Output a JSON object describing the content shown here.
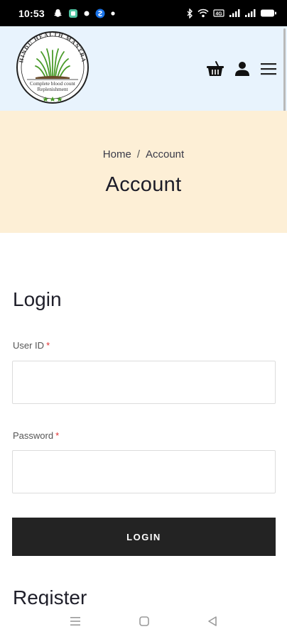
{
  "status_bar": {
    "time": "10:53",
    "left_icons": [
      "snapchat-icon",
      "app-icon",
      "dot-icon",
      "shazam-icon",
      "dot-icon"
    ],
    "right_icons": [
      "bluetooth-icon",
      "wifi-icon",
      "volte-icon",
      "signal-icon",
      "signal-icon",
      "battery-icon"
    ]
  },
  "header": {
    "logo": {
      "top_text": "HINDU HEALTH MANTRA",
      "line1": "Complete blood count",
      "line2": "Replenishment"
    },
    "icons": [
      "basket-icon",
      "user-icon",
      "menu-icon"
    ]
  },
  "breadcrumb": {
    "home": "Home",
    "separator": "/",
    "current": "Account"
  },
  "page_title": "Account",
  "login": {
    "heading": "Login",
    "user_id_label": "User ID",
    "password_label": "Password",
    "required_mark": "*",
    "user_id_value": "",
    "password_value": "",
    "button_label": "LOGIN"
  },
  "register": {
    "heading": "Register"
  },
  "colors": {
    "header_bg": "#e8f3fd",
    "title_band_bg": "#fdefd6",
    "button_bg": "#232323",
    "required": "#e03030"
  }
}
